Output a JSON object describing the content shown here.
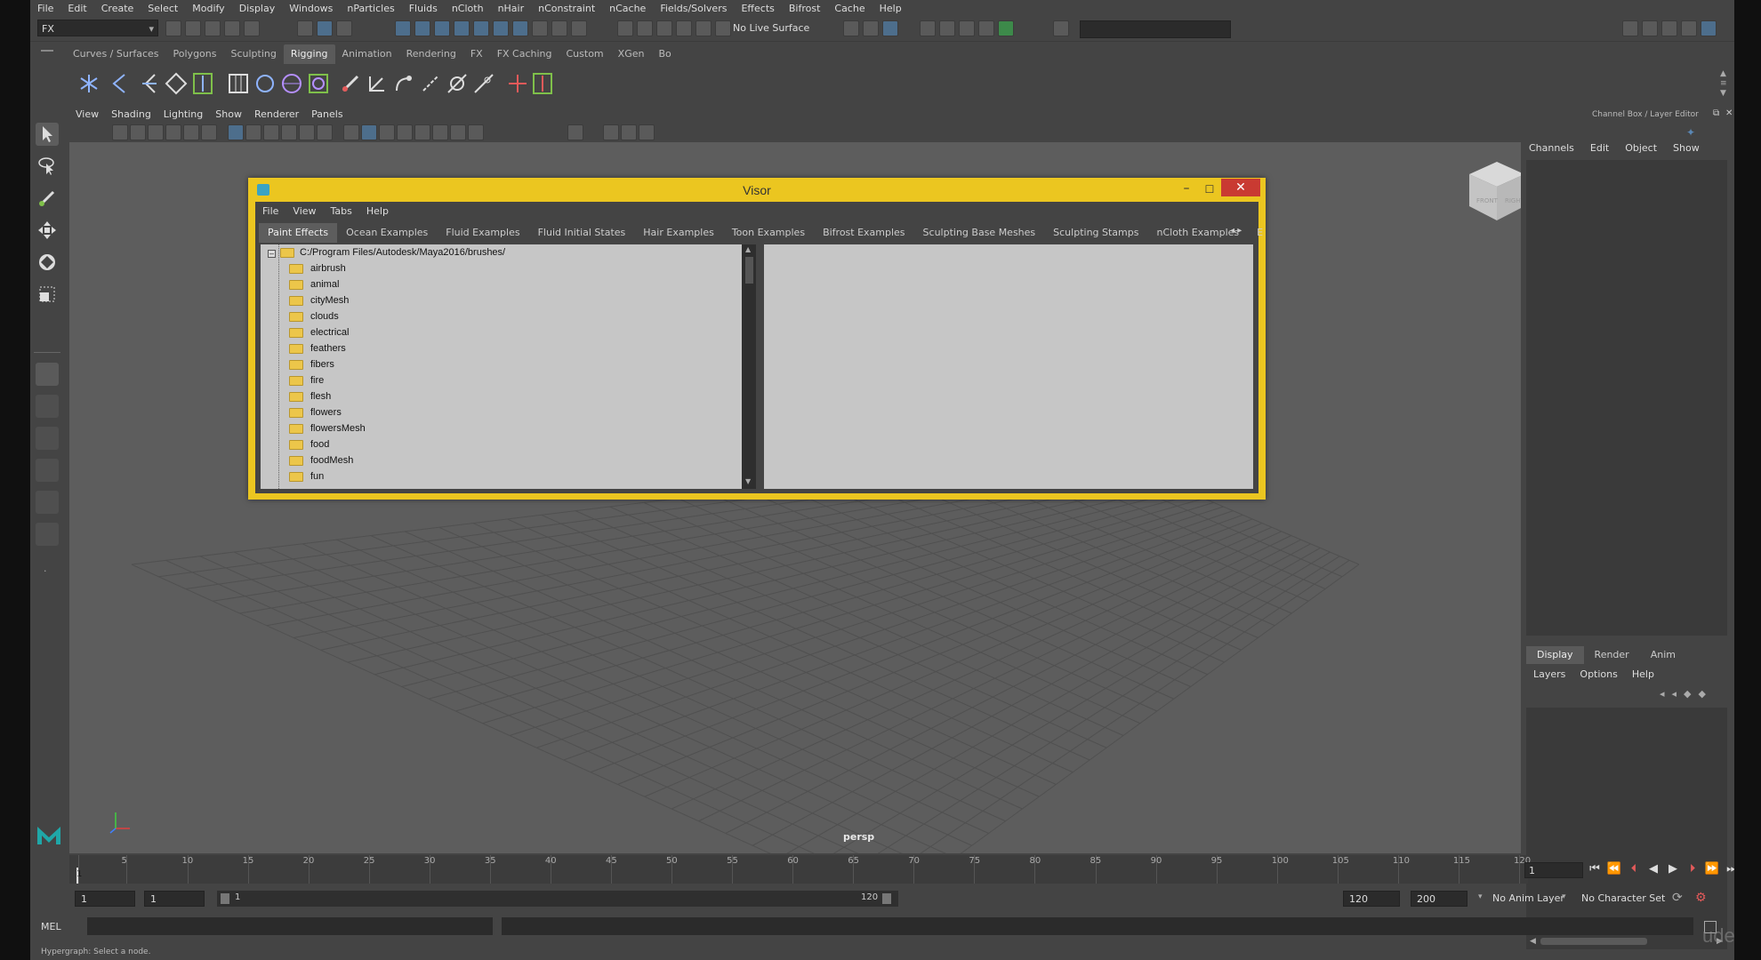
{
  "menubar": [
    "File",
    "Edit",
    "Create",
    "Select",
    "Modify",
    "Display",
    "Windows",
    "nParticles",
    "Fluids",
    "nCloth",
    "nHair",
    "nConstraint",
    "nCache",
    "Fields/Solvers",
    "Effects",
    "Bifrost",
    "Cache",
    "Help"
  ],
  "statusline": {
    "menuset": "FX",
    "live_surface": "No Live Surface"
  },
  "shelf_tabs": [
    "Curves / Surfaces",
    "Polygons",
    "Sculpting",
    "Rigging",
    "Animation",
    "Rendering",
    "FX",
    "FX Caching",
    "Custom",
    "XGen",
    "Bo"
  ],
  "shelf_active": "Rigging",
  "panel_menu": [
    "View",
    "Shading",
    "Lighting",
    "Show",
    "Renderer",
    "Panels"
  ],
  "viewport": {
    "camera": "persp",
    "viewcube_front": "FRONT",
    "viewcube_right": "RIGHT"
  },
  "channel_box": {
    "title": "Channel Box / Layer Editor",
    "menu": [
      "Channels",
      "Edit",
      "Object",
      "Show"
    ],
    "layer_tabs": [
      "Display",
      "Render",
      "Anim"
    ],
    "layer_menu": [
      "Layers",
      "Options",
      "Help"
    ]
  },
  "timeline": {
    "ticks": [
      1,
      5,
      10,
      15,
      20,
      25,
      30,
      35,
      40,
      45,
      50,
      55,
      60,
      65,
      70,
      75,
      80,
      85,
      90,
      95,
      100,
      105,
      110,
      115,
      120
    ],
    "current_frame": "1",
    "current_marker": "1"
  },
  "range": {
    "start": "1",
    "anim_start": "1",
    "range_start": "1",
    "range_end": "120",
    "end": "120",
    "anim_end": "200",
    "anim_layer": "No Anim Layer",
    "char_set": "No Character Set"
  },
  "mel": {
    "label": "MEL",
    "help": "Hypergraph: Select a node."
  },
  "visor": {
    "title": "Visor",
    "menu": [
      "File",
      "View",
      "Tabs",
      "Help"
    ],
    "tabs": [
      "Paint Effects",
      "Ocean Examples",
      "Fluid Examples",
      "Fluid Initial States",
      "Hair Examples",
      "Toon Examples",
      "Bifrost Examples",
      "Sculpting Base Meshes",
      "Sculpting Stamps",
      "nCloth Examples",
      "E"
    ],
    "active_tab": "Paint Effects",
    "root_path": "C:/Program Files/Autodesk/Maya2016/brushes/",
    "folders": [
      "airbrush",
      "animal",
      "cityMesh",
      "clouds",
      "electrical",
      "feathers",
      "fibers",
      "fire",
      "flesh",
      "flowers",
      "flowersMesh",
      "food",
      "foodMesh",
      "fun"
    ]
  },
  "watermark": "udemy",
  "colors": {
    "visor_border": "#ebc620",
    "close": "#c93a32",
    "viewport_bg": "#5d5d5d",
    "ui_bg": "#444444"
  }
}
